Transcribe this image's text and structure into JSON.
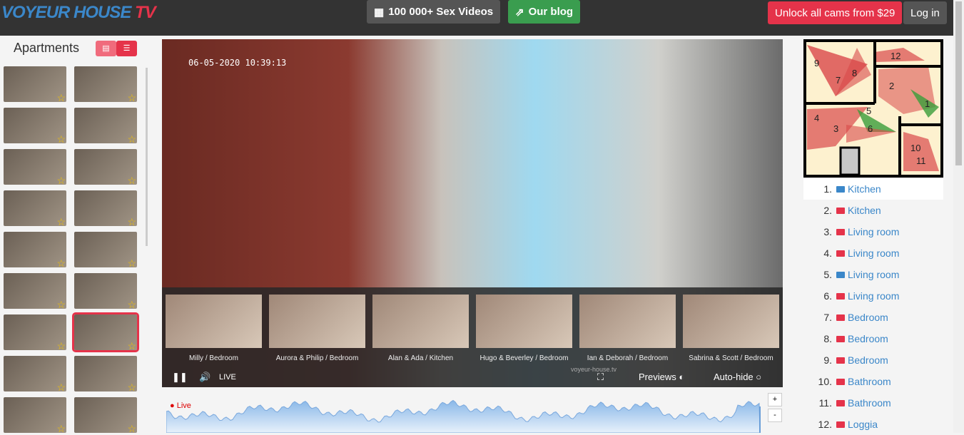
{
  "header": {
    "logo": "VOYEUR HOUSE",
    "logo_tv": "TV",
    "videos_btn": "100 000+ Sex Videos",
    "blog_btn": "Our blog",
    "unlock_btn": "Unlock all cams from $29",
    "login_btn": "Log in"
  },
  "sidebar": {
    "title": "Apartments",
    "thumb_count": 18,
    "selected_index": 13
  },
  "player": {
    "timestamp": "06-05-2020 10:39:13",
    "live_label": "LIVE",
    "previews_label": "Previews",
    "autohide_label": "Auto-hide",
    "watermark": "voyeur-house.tv",
    "previews": [
      "Milly / Bedroom",
      "Aurora & Philip / Bedroom",
      "Alan & Ada / Kitchen",
      "Hugo & Beverley / Bedroom",
      "Ian & Deborah / Bedroom",
      "Sabrina & Scott / Bedroom"
    ]
  },
  "timeline": {
    "live": "Live",
    "zoom_in": "+",
    "zoom_out": "-"
  },
  "cameras": [
    {
      "n": "1.",
      "room": "Kitchen",
      "color": "#3b87c9"
    },
    {
      "n": "2.",
      "room": "Kitchen",
      "color": "#e5334a"
    },
    {
      "n": "3.",
      "room": "Living room",
      "color": "#e5334a"
    },
    {
      "n": "4.",
      "room": "Living room",
      "color": "#e5334a"
    },
    {
      "n": "5.",
      "room": "Living room",
      "color": "#3b87c9"
    },
    {
      "n": "6.",
      "room": "Living room",
      "color": "#e5334a"
    },
    {
      "n": "7.",
      "room": "Bedroom",
      "color": "#e5334a"
    },
    {
      "n": "8.",
      "room": "Bedroom",
      "color": "#e5334a"
    },
    {
      "n": "9.",
      "room": "Bedroom",
      "color": "#e5334a"
    },
    {
      "n": "10.",
      "room": "Bathroom",
      "color": "#e5334a"
    },
    {
      "n": "11.",
      "room": "Bathroom",
      "color": "#e5334a"
    },
    {
      "n": "12.",
      "room": "Loggia",
      "color": "#e5334a"
    }
  ],
  "map_labels": [
    "1",
    "2",
    "3",
    "4",
    "5",
    "6",
    "7",
    "8",
    "9",
    "10",
    "11",
    "12"
  ]
}
